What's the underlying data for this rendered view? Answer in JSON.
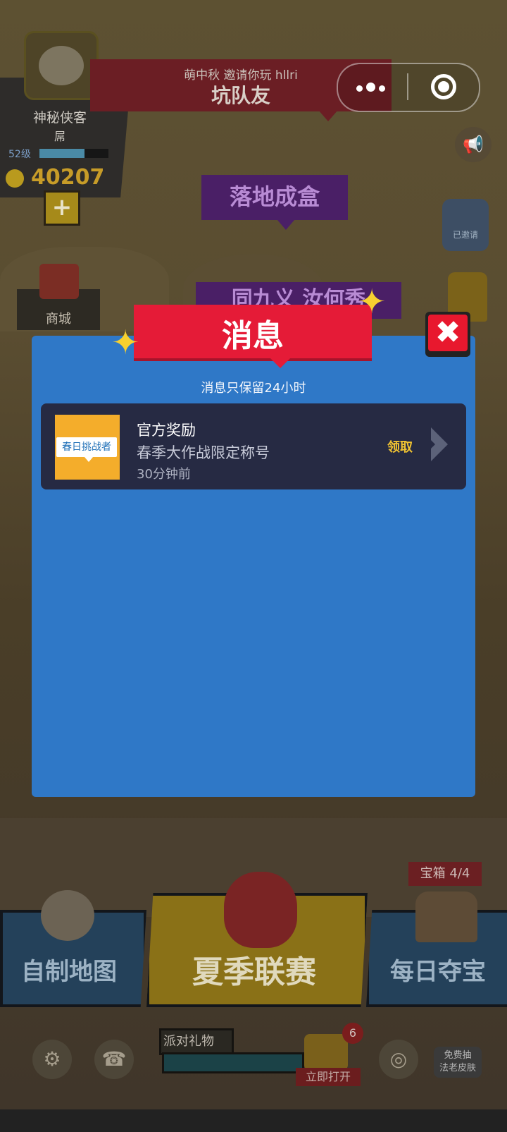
{
  "background": {
    "profile": {
      "name": "神秘侠客",
      "title": "屌",
      "level": "52级",
      "level_progress": 0.65,
      "coins": "40207",
      "add_label": "+"
    },
    "invite": {
      "line1": "萌中秋 邀请你玩 hllri",
      "line2": "坑队友"
    },
    "tags": {
      "land": "落地成盒",
      "second": "同九义 汝何秀"
    },
    "badge_label": "已邀请",
    "shop_label": "商城",
    "menu": {
      "diy_map": "自制地图",
      "summer_league": "夏季联赛",
      "daily_treasure": "每日夺宝",
      "chest_count": "宝箱 4/4"
    },
    "bottom": {
      "party_gift": "派对礼物",
      "open_now": "立即打开",
      "party_count": "6",
      "free_draw": "免费抽\n法老皮肤"
    }
  },
  "modal": {
    "title": "消息",
    "note": "消息只保留24小时",
    "close_symbol": "✖",
    "messages": [
      {
        "thumb_tag": "春日挑战者",
        "title": "官方奖励",
        "desc": "春季大作战限定称号",
        "time": "30分钟前",
        "action": "领取"
      }
    ]
  },
  "colors": {
    "modal_bg": "#2f78c7",
    "banner": "#e51b37",
    "card": "#262a43",
    "claim": "#f2c431"
  },
  "icons": [
    "more-icon",
    "close-miniprogram-icon",
    "megaphone-icon",
    "coin-icon",
    "settings-icon",
    "headset-icon",
    "target-icon",
    "chevron-right-icon",
    "close-icon",
    "sparkle-icon"
  ]
}
